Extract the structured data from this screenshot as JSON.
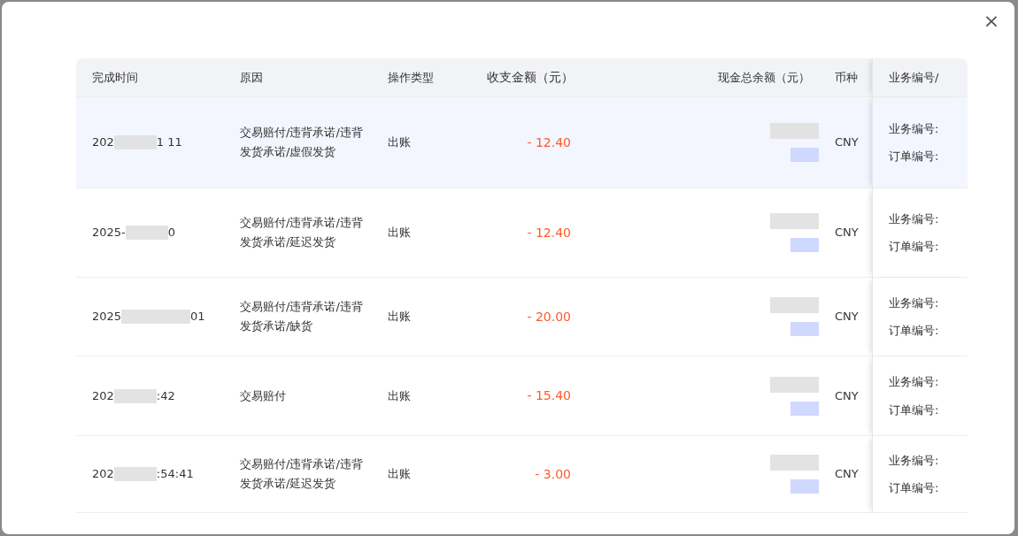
{
  "dialog": {
    "close_button": "×"
  },
  "table": {
    "columns": [
      "完成时间",
      "原因",
      "操作类型",
      "收支金额（元）",
      "现金总余额（元）",
      "币种",
      "业务编号/"
    ],
    "rows": [
      {
        "selected": true,
        "time_start": "202",
        "time_end": "1 11",
        "reason": "交易赔付/违背承诺/违背发货承诺/虚假发货",
        "type": "出账",
        "amount": "- 12.40",
        "currency": "CNY",
        "business_label": "业务编号:",
        "order_label": "订单编号:"
      },
      {
        "selected": false,
        "time_start": "2025-",
        "time_end": "0",
        "reason": "交易赔付/违背承诺/违背发货承诺/延迟发货",
        "type": "出账",
        "amount": "- 12.40",
        "currency": "CNY",
        "business_label": "业务编号:",
        "order_label": "订单编号:"
      },
      {
        "selected": false,
        "time_start": "2025",
        "time_end": "01",
        "reason": "交易赔付/违背承诺/违背发货承诺/缺货",
        "type": "出账",
        "amount": "- 20.00",
        "currency": "CNY",
        "business_label": "业务编号:",
        "order_label": "订单编号:"
      },
      {
        "selected": false,
        "time_start": "202",
        "time_end": ":42",
        "reason": "交易赔付",
        "type": "出账",
        "amount": "- 15.40",
        "currency": "CNY",
        "business_label": "业务编号:",
        "order_label": "订单编号:"
      },
      {
        "selected": false,
        "time_start": "202",
        "time_end": ":54:41",
        "reason": "交易赔付/违背承诺/违背发货承诺/延迟发货",
        "type": "出账",
        "amount": "- 3.00",
        "currency": "CNY",
        "business_label": "业务编号:",
        "order_label": "订单编号:"
      }
    ]
  }
}
